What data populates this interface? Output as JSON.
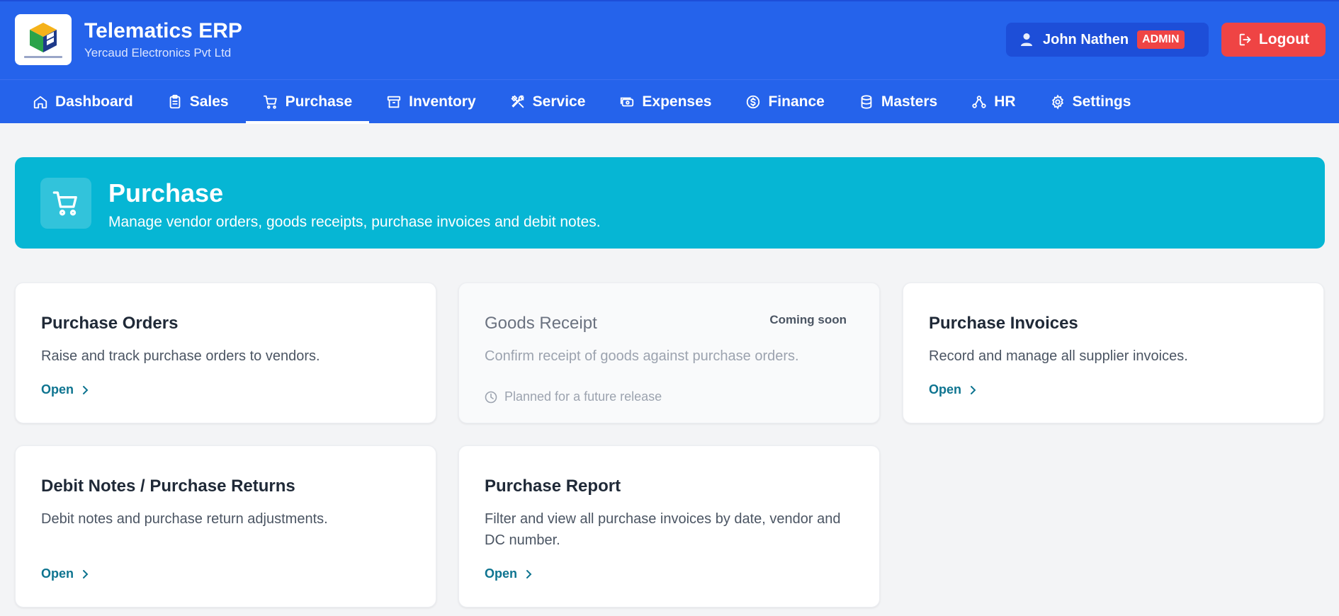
{
  "header": {
    "title": "Telematics ERP",
    "subtitle": "Yercaud Electronics Pvt Ltd",
    "user_name": "John Nathen",
    "role": "ADMIN",
    "logout_label": "Logout"
  },
  "nav": {
    "tabs": [
      {
        "label": "Dashboard",
        "icon": "home-icon"
      },
      {
        "label": "Sales",
        "icon": "clipboard-icon"
      },
      {
        "label": "Purchase",
        "icon": "cart-icon",
        "active": true
      },
      {
        "label": "Inventory",
        "icon": "archive-icon"
      },
      {
        "label": "Service",
        "icon": "tools-icon"
      },
      {
        "label": "Expenses",
        "icon": "money-icon"
      },
      {
        "label": "Finance",
        "icon": "dollar-icon"
      },
      {
        "label": "Masters",
        "icon": "database-icon"
      },
      {
        "label": "HR",
        "icon": "network-icon"
      },
      {
        "label": "Settings",
        "icon": "gear-icon"
      }
    ]
  },
  "banner": {
    "title": "Purchase",
    "description": "Manage vendor orders, goods receipts, purchase invoices and debit notes."
  },
  "cards": [
    {
      "title": "Purchase Orders",
      "description": "Raise and track purchase orders to vendors.",
      "link": "Open"
    },
    {
      "title": "Goods Receipt",
      "description": "Confirm receipt of goods against purchase orders.",
      "badge": "Coming soon",
      "note": "Planned for a future release"
    },
    {
      "title": "Purchase Invoices",
      "description": "Record and manage all supplier invoices.",
      "link": "Open"
    },
    {
      "title": "Debit Notes / Purchase Returns",
      "description": "Debit notes and purchase return adjustments.",
      "link": "Open"
    },
    {
      "title": "Purchase Report",
      "description": "Filter and view all purchase invoices by date, vendor and DC number.",
      "link": "Open"
    }
  ],
  "colors": {
    "header_bg": "#2563eb",
    "banner_bg": "#06b6d4",
    "logout_bg": "#ef4444",
    "link": "#0e7490"
  }
}
